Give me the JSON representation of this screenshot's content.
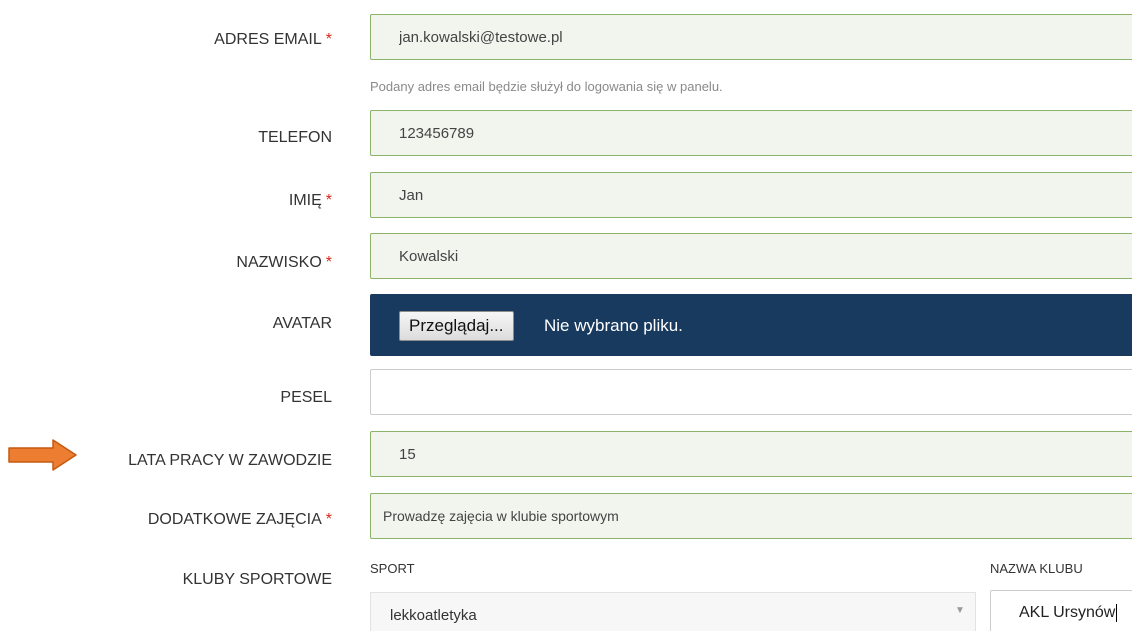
{
  "form": {
    "email": {
      "label": "ADRES EMAIL",
      "required_mark": "*",
      "value": "jan.kowalski@testowe.pl",
      "help": "Podany adres email będzie służył do logowania się w panelu."
    },
    "phone": {
      "label": "TELEFON",
      "value": "123456789"
    },
    "first_name": {
      "label": "IMIĘ",
      "required_mark": "*",
      "value": "Jan"
    },
    "last_name": {
      "label": "NAZWISKO",
      "required_mark": "*",
      "value": "Kowalski"
    },
    "avatar": {
      "label": "AVATAR",
      "browse_button": "Przeglądaj...",
      "file_status": "Nie wybrano pliku."
    },
    "pesel": {
      "label": "PESEL",
      "value": ""
    },
    "years_of_work": {
      "label": "LATA PRACY W ZAWODZIE",
      "value": "15"
    },
    "additional_classes": {
      "label": "DODATKOWE ZAJĘCIA",
      "required_mark": "*",
      "value": "Prowadzę zajęcia w klubie sportowym"
    },
    "sport_clubs": {
      "label": "KLUBY SPORTOWE",
      "sport_label": "SPORT",
      "club_name_label": "NAZWA KLUBU",
      "sport_selected": "lekkoatletyka",
      "club_name_value": "AKL Ursynów"
    }
  },
  "annotation": {
    "arrow_icon": "right-arrow-icon",
    "arrow_color": "#ed7d31"
  },
  "colors": {
    "required": "#d9261c",
    "field_border_valid": "#8cb36a",
    "field_background_valid": "#f2f5ee",
    "file_bar_background": "#173a5e"
  }
}
